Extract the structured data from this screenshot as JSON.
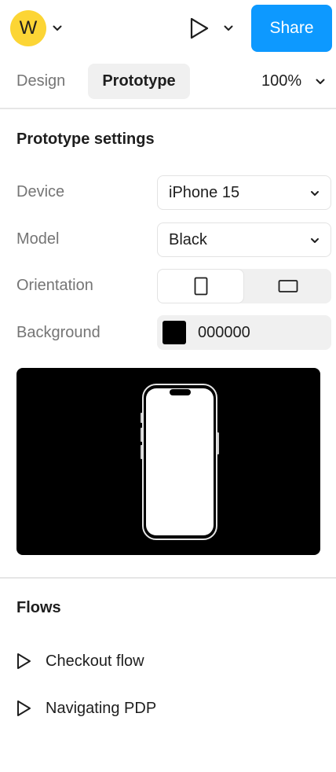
{
  "user": {
    "avatar_initial": "W"
  },
  "toolbar": {
    "share_label": "Share"
  },
  "tabs": [
    {
      "label": "Design",
      "active": false
    },
    {
      "label": "Prototype",
      "active": true
    }
  ],
  "zoom": {
    "value": "100%"
  },
  "prototype_settings": {
    "title": "Prototype settings",
    "device": {
      "label": "Device",
      "value": "iPhone 15"
    },
    "model": {
      "label": "Model",
      "value": "Black"
    },
    "orientation": {
      "label": "Orientation",
      "selected": "portrait",
      "options": [
        "portrait",
        "landscape"
      ]
    },
    "background": {
      "label": "Background",
      "hex": "000000",
      "color": "#000000"
    }
  },
  "flows": {
    "title": "Flows",
    "items": [
      {
        "label": "Checkout flow"
      },
      {
        "label": "Navigating PDP"
      }
    ]
  },
  "colors": {
    "accent": "#0d99ff",
    "avatar": "#fcd535"
  }
}
